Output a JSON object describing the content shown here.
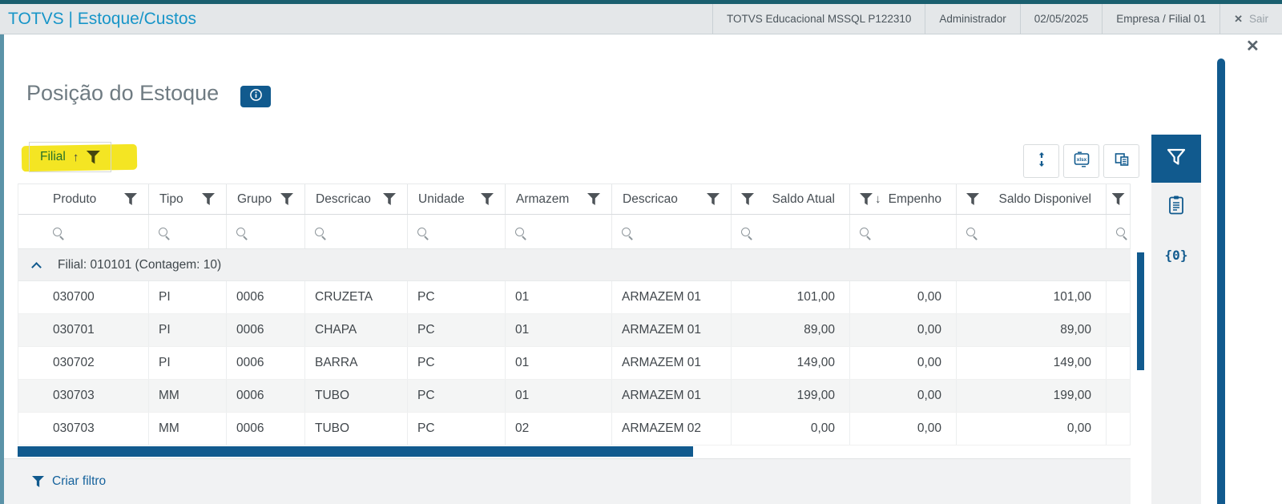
{
  "topbar": {
    "title": "TOTVS | Estoque/Custos",
    "environment": "TOTVS Educacional MSSQL P122310",
    "user": "Administrador",
    "date": "02/05/2025",
    "company_branch": "Empresa / Filial 01",
    "logout": {
      "icon_glyph": "✕",
      "label": "Sair"
    }
  },
  "page": {
    "title": "Posição do Estoque",
    "close_glyph": "✕"
  },
  "grouping_chip": {
    "label": "Filial",
    "sort_glyph": "↑"
  },
  "toolbar": {
    "buttons": [
      {
        "name": "adjust-rows"
      },
      {
        "name": "export-xlsx",
        "icon_text": "xlsx"
      },
      {
        "name": "copy"
      }
    ]
  },
  "sidebar": {
    "tabs": [
      {
        "name": "filter",
        "active": true
      },
      {
        "name": "clipboard",
        "active": false
      },
      {
        "name": "variables",
        "active": false,
        "label": "{0}"
      }
    ]
  },
  "table": {
    "columns": [
      {
        "label": "Produto",
        "align": "left"
      },
      {
        "label": "Tipo",
        "align": "left"
      },
      {
        "label": "Grupo",
        "align": "left"
      },
      {
        "label": "Descricao",
        "align": "left"
      },
      {
        "label": "Unidade",
        "align": "left"
      },
      {
        "label": "Armazem",
        "align": "left"
      },
      {
        "label": "Descricao",
        "align": "left"
      },
      {
        "label": "Saldo Atual",
        "align": "right"
      },
      {
        "label": "Empenho",
        "align": "right",
        "sort_glyph": "↓"
      },
      {
        "label": "Saldo Disponivel",
        "align": "right"
      }
    ],
    "group_row": {
      "label": "Filial: 010101 (Contagem: 10)"
    },
    "rows": [
      [
        "030700",
        "PI",
        "0006",
        "CRUZETA",
        "PC",
        "01",
        "ARMAZEM 01",
        "101,00",
        "0,00",
        "101,00"
      ],
      [
        "030701",
        "PI",
        "0006",
        "CHAPA",
        "PC",
        "01",
        "ARMAZEM 01",
        "89,00",
        "0,00",
        "89,00"
      ],
      [
        "030702",
        "PI",
        "0006",
        "BARRA",
        "PC",
        "01",
        "ARMAZEM 01",
        "149,00",
        "0,00",
        "149,00"
      ],
      [
        "030703",
        "MM",
        "0006",
        "TUBO",
        "PC",
        "01",
        "ARMAZEM 01",
        "199,00",
        "0,00",
        "199,00"
      ],
      [
        "030703",
        "MM",
        "0006",
        "TUBO",
        "PC",
        "02",
        "ARMAZEM 02",
        "0,00",
        "0,00",
        "0,00"
      ]
    ]
  },
  "footer": {
    "create_filter_label": "Criar filtro"
  },
  "colors": {
    "accent": "#115a8e",
    "title_cyan": "#1795c8",
    "highlight_yellow": "#f2e105"
  }
}
